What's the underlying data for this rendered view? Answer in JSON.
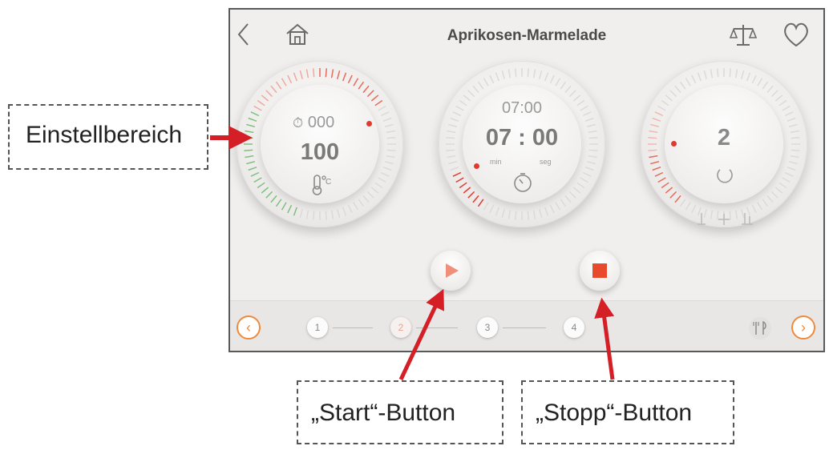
{
  "screen": {
    "title": "Aprikosen-Marmelade",
    "icons": [
      "back-chevron-icon",
      "home-icon",
      "scale-icon",
      "heart-icon"
    ],
    "dial_temperature": {
      "top_value": "000",
      "value": "100",
      "unit_icon": "thermometer-celsius-icon"
    },
    "dial_time": {
      "top_value": "07:00",
      "value": "07 : 00",
      "label_min": "min",
      "label_seg": "seg",
      "icon": "timer-icon"
    },
    "dial_speed": {
      "value": "2",
      "icon": "rotation-icon"
    },
    "controls": {
      "start_icon": "play-icon",
      "stop_icon": "stop-icon"
    },
    "steps": [
      "1",
      "2",
      "3",
      "4"
    ],
    "active_step": "2",
    "accent_color": "#e2392d",
    "nav_color": "#f08a3c"
  },
  "annotations": {
    "einstellbereich": "Einstellbereich",
    "start_button": "„Start“-Button",
    "stopp_button": "„Stopp“-Button"
  }
}
